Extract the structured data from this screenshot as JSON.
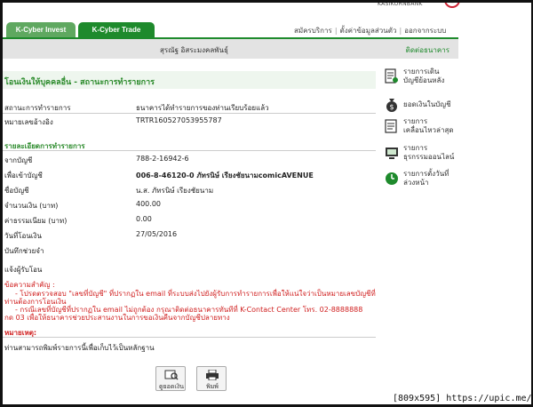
{
  "header": {
    "bank_name": "KASIKORNBANK",
    "tabs": [
      {
        "label": "K-Cyber Invest"
      },
      {
        "label": "K-Cyber Trade"
      }
    ],
    "links": [
      "สมัครบริการ",
      "ตั้งค่าข้อมูลส่วนตัว",
      "ออกจากระบบ"
    ],
    "user_name": "สุรณัฐ อิสระมงคลพันธุ์",
    "contact_label": "ติดต่อธนาคาร"
  },
  "page": {
    "title": "โอนเงินให้บุคคลอื่น - สถานะการทำรายการ",
    "status_label": "สถานะการทำรายการ",
    "status_value": "ธนาคารได้ทำรายการของท่านเรียบร้อยแล้ว",
    "ref_label": "หมายเลขอ้างอิง",
    "ref_value": "TRTR160527053955787",
    "details_heading": "รายละเอียดการทำรายการ",
    "details": [
      {
        "label": "จากบัญชี",
        "value": "788-2-16942-6",
        "bold": false
      },
      {
        "label": "เพื่อเข้าบัญชี",
        "value": "006-8-46120-0 ภัทรนิษ์ เรียงชัยนามcomicAVENUE",
        "bold": true
      },
      {
        "label": "ชื่อบัญชี",
        "value": "น.ส. ภัทรนิษ์ เรียงชัยนาม",
        "bold": false
      },
      {
        "label": "จำนวนเงิน (บาท)",
        "value": "400.00",
        "bold": false
      },
      {
        "label": "ค่าธรรมเนียม (บาท)",
        "value": "0.00",
        "bold": false
      },
      {
        "label": "วันที่โอนเงิน",
        "value": "27/05/2016",
        "bold": false
      },
      {
        "label": "บันทึกช่วยจำ",
        "value": "",
        "bold": false
      }
    ],
    "notify_label": "แจ้งผู้รับโอน",
    "important_heading": "ข้อความสำคัญ :",
    "important_lines": [
      "- โปรดตรวจสอบ \"เลขที่บัญชี\" ที่ปรากฏใน email ที่ระบบส่งไปยังผู้รับการทำรายการเพื่อให้แน่ใจว่าเป็นหมายเลขบัญชีที่",
      "ท่านต้องการโอนเงิน",
      "- กรณีเลขที่บัญชีที่ปรากฏใน email ไม่ถูกต้อง กรุณาติดต่อธนาคารทันทีที่ K-Contact Center โทร. 02-8888888",
      "กด 03 เพื่อให้ธนาคารช่วยประสานงานในการขอเงินคืนจากบัญชีปลายทาง"
    ],
    "note_heading": "หมายเหตุ:",
    "note_text": "ท่านสามารถพิมพ์รายการนี้เพื่อเก็บไว้เป็นหลักฐาน"
  },
  "side_menu": [
    {
      "label": "รายการเดิน บัญชีย้อนหลัง",
      "lines": [
        "รายการเดิน",
        "บัญชีย้อนหลัง"
      ],
      "icon": "statement-icon"
    },
    {
      "label": "ยอดเงินในบัญชี",
      "lines": [
        "ยอดเงินในบัญชี"
      ],
      "icon": "money-bag-icon"
    },
    {
      "label": "รายการ เคลื่อนไหวล่าสุด",
      "lines": [
        "รายการ",
        "เคลื่อนไหวล่าสุด"
      ],
      "icon": "recent-transactions-icon"
    },
    {
      "label": "รายการ ธุรกรรมออนไลน์",
      "lines": [
        "รายการ",
        "ธุรกรรมออนไลน์"
      ],
      "icon": "online-transactions-icon"
    },
    {
      "label": "รายการตั้งวันที่ ล่วงหน้า",
      "lines": [
        "รายการตั้งวันที่",
        "ล่วงหน้า"
      ],
      "icon": "clock-icon"
    }
  ],
  "buttons": {
    "view_balance": "ดูยอดเงิน",
    "print": "พิมพ์"
  },
  "watermark": "[809x595] https://upic.me/",
  "colors": {
    "brand_green": "#1e8a2c",
    "light_green_tab": "#5fa860",
    "warning_red": "#d02020"
  }
}
